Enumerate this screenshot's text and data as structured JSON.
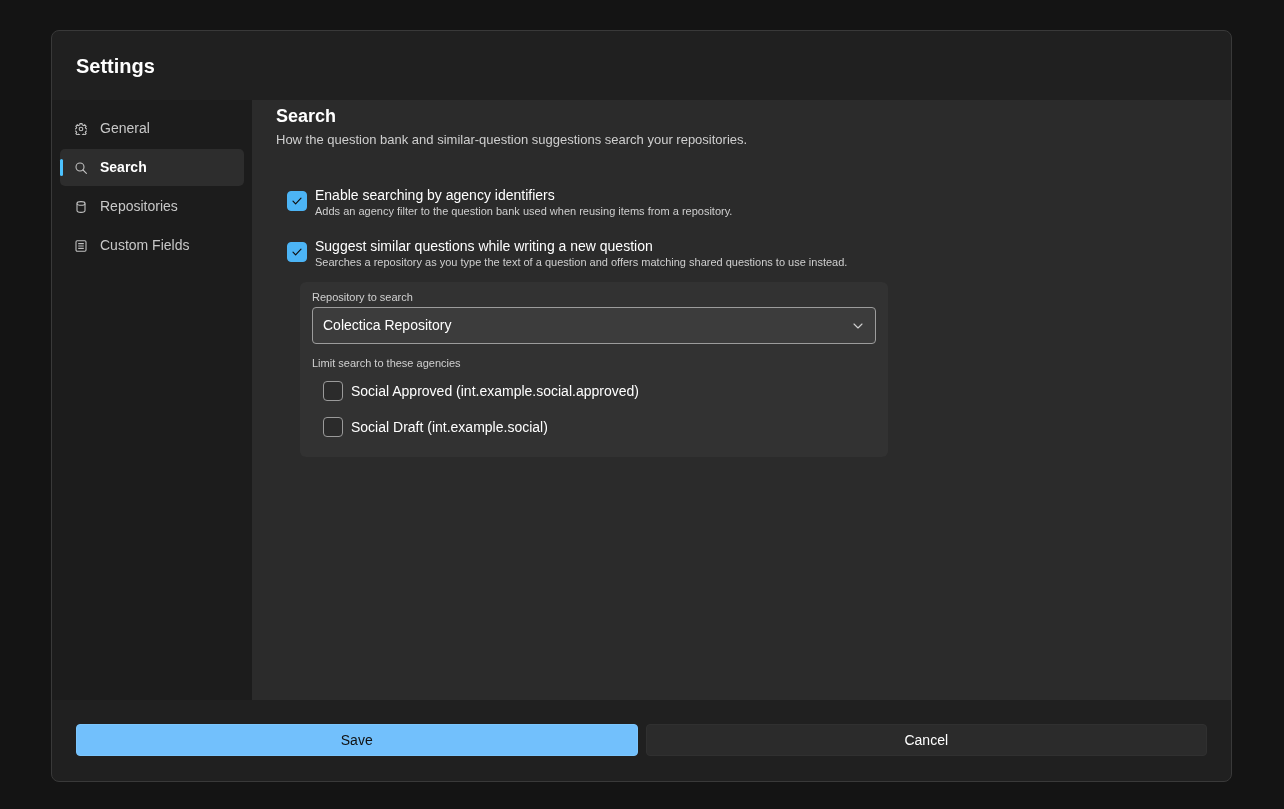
{
  "window": {
    "title": "Settings"
  },
  "sidebar": {
    "items": [
      {
        "label": "General",
        "selected": false
      },
      {
        "label": "Search",
        "selected": true
      },
      {
        "label": "Repositories",
        "selected": false
      },
      {
        "label": "Custom Fields",
        "selected": false
      }
    ]
  },
  "section": {
    "title": "Search",
    "description": "How the question bank and similar-question suggestions search your repositories."
  },
  "options": [
    {
      "label": "Enable searching by agency identifiers",
      "description": "Adds an agency filter to the question bank used when reusing items from a repository.",
      "checked": true
    },
    {
      "label": "Suggest similar questions while writing a new question",
      "description": "Searches a repository as you type the text of a question and offers matching shared questions to use instead.",
      "checked": true
    }
  ],
  "repository_panel": {
    "label": "Repository to search",
    "select": {
      "value": "Colectica Repository"
    },
    "agencies_label": "Limit search to these agencies",
    "agencies": [
      {
        "label": "Social Approved (int.example.social.approved)",
        "checked": false
      },
      {
        "label": "Social Draft (int.example.social)",
        "checked": false
      }
    ]
  },
  "buttons": [
    {
      "label": "Save",
      "kind": "primary"
    },
    {
      "label": "Cancel",
      "kind": "secondary"
    }
  ]
}
